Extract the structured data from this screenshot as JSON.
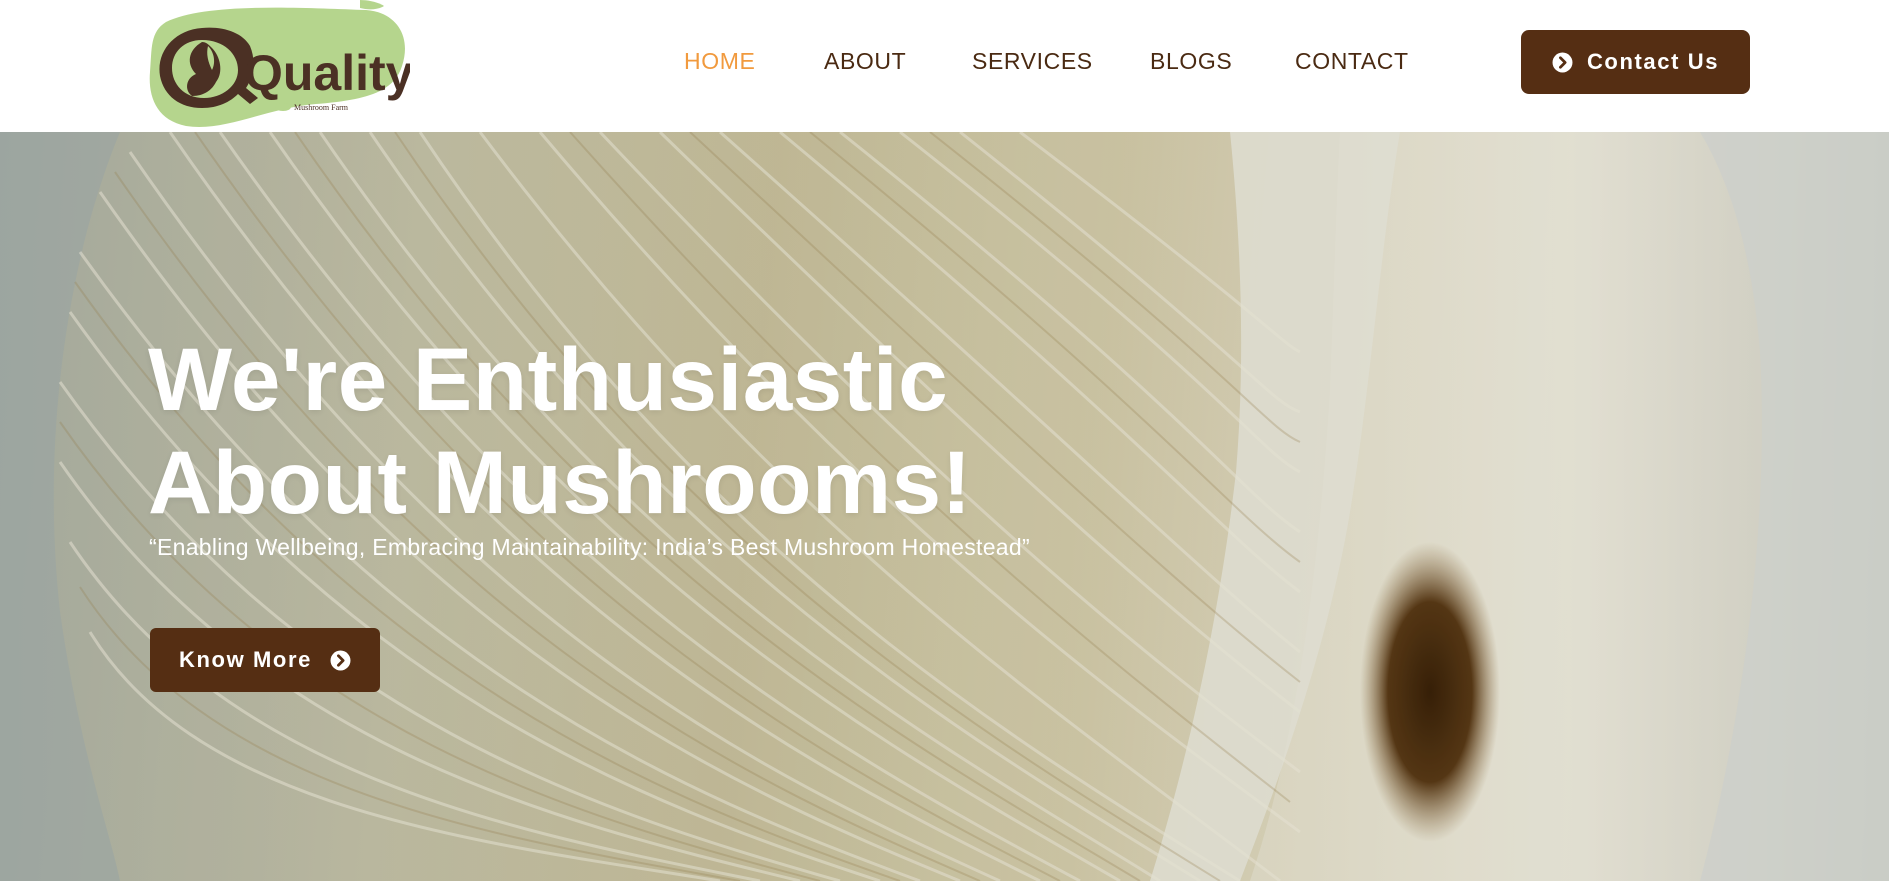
{
  "brand": {
    "logo_text": "Quality",
    "logo_tagline": "Mushroom Farm"
  },
  "nav": {
    "items": [
      {
        "label": "HOME",
        "active": true
      },
      {
        "label": "ABOUT",
        "active": false
      },
      {
        "label": "SERVICES",
        "active": false
      },
      {
        "label": "BLOGS",
        "active": false
      },
      {
        "label": "CONTACT",
        "active": false
      }
    ]
  },
  "header": {
    "cta_label": "Contact Us",
    "cta_icon": "chevron-circle-right-icon"
  },
  "hero": {
    "title_line1": "We're Enthusiastic",
    "title_line2": "About Mushrooms!",
    "subtitle": "“Enabling Wellbeing, Embracing Maintainability: India’s Best Mushroom Homestead”",
    "button_label": "Know More",
    "button_icon": "chevron-circle-right-icon",
    "background_image": "oyster-mushroom-gills"
  },
  "colors": {
    "brand_brown": "#552e13",
    "nav_text": "#4a2a12",
    "nav_active": "#f19a3e",
    "logo_green": "#b5d58d"
  }
}
